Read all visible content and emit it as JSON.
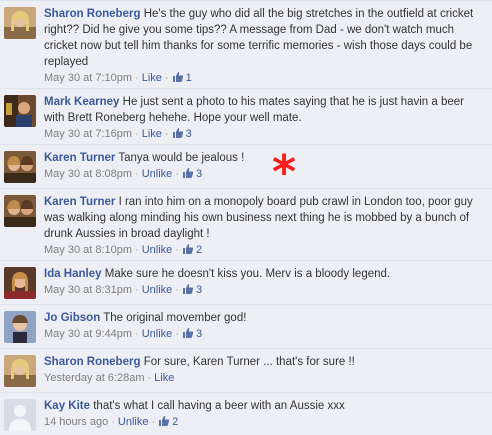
{
  "comments": [
    {
      "author": "Sharon Roneberg",
      "text": "He's the guy who did all the big stretches in the outfield at cricket right?? Did he give you some tips?? A message from Dad - we don't watch much cricket now but tell him thanks for some terrific memories - wish those days could be replayed",
      "time": "May 30 at 7:10pm",
      "action": "Like",
      "likes": "1"
    },
    {
      "author": "Mark Kearney",
      "text": "He just sent a photo to his mates saying that he is just havin a beer with Brett Roneberg hehehe. Hope your well mate.",
      "time": "May 30 at 7:16pm",
      "action": "Like",
      "likes": "3"
    },
    {
      "author": "Karen Turner",
      "text": "Tanya would be jealous !",
      "time": "May 30 at 8:08pm",
      "action": "Unlike",
      "likes": "3"
    },
    {
      "author": "Karen Turner",
      "text": "I ran into him on a monopoly board pub crawl in London too, poor guy was walking along minding his own business next thing he is mobbed by a bunch of drunk Aussies in broad daylight !",
      "time": "May 30 at 8:10pm",
      "action": "Unlike",
      "likes": "2"
    },
    {
      "author": "Ida Hanley",
      "text": "Make sure he doesn't kiss you. Merv is a bloody legend.",
      "time": "May 30 at 8:31pm",
      "action": "Unlike",
      "likes": "3"
    },
    {
      "author": "Jo Gibson",
      "text": "The original movember god!",
      "time": "May 30 at 9:44pm",
      "action": "Unlike",
      "likes": "3"
    },
    {
      "author": "Sharon Roneberg",
      "text": "For sure, Karen Turner ... that's for sure !!",
      "time": "Yesterday at 6:28am",
      "action": "Like",
      "likes": ""
    },
    {
      "author": "Kay Kite",
      "text": "that's what I call having a beer with an Aussie xxx",
      "time": "14 hours ago",
      "action": "Unlike",
      "likes": "2"
    }
  ],
  "annotation_mark": "*",
  "colors": {
    "link": "#3b5998",
    "background": "#edeff4",
    "annotation": "#ff1a1a"
  }
}
